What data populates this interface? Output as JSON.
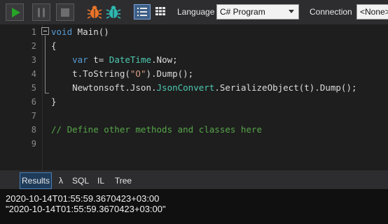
{
  "toolbar": {
    "icons": {
      "run": "play-icon",
      "pause": "pause-icon",
      "stop": "stop-icon",
      "debug": "bug-icon",
      "debug_alt": "bug-alt-icon",
      "rich_text": "rich-text-view-icon",
      "data_grid": "data-grid-view-icon"
    },
    "language_label": "Language",
    "language_value": "C# Program",
    "connection_label": "Connection",
    "connection_value": "<None>"
  },
  "editor": {
    "line_numbers": [
      "1",
      "2",
      "3",
      "4",
      "5",
      "6",
      "7",
      "8",
      "9"
    ],
    "lines": [
      {
        "parts": [
          {
            "t": "void",
            "c": "kw"
          },
          {
            "t": " Main()",
            "c": "pl"
          }
        ]
      },
      {
        "parts": [
          {
            "t": "{",
            "c": "pl"
          }
        ]
      },
      {
        "parts": [
          {
            "t": "    ",
            "c": "pl"
          },
          {
            "t": "var",
            "c": "kw"
          },
          {
            "t": " t= ",
            "c": "pl"
          },
          {
            "t": "DateTime",
            "c": "ty"
          },
          {
            "t": ".Now;",
            "c": "pl"
          }
        ]
      },
      {
        "parts": [
          {
            "t": "    t.ToString(",
            "c": "pl"
          },
          {
            "t": "\"O\"",
            "c": "str"
          },
          {
            "t": ").Dump();",
            "c": "pl"
          }
        ]
      },
      {
        "parts": [
          {
            "t": "    Newtonsoft.Json.",
            "c": "pl"
          },
          {
            "t": "JsonConvert",
            "c": "ty"
          },
          {
            "t": ".SerializeObject(t).Dump();",
            "c": "pl"
          }
        ]
      },
      {
        "parts": [
          {
            "t": "}",
            "c": "pl"
          }
        ]
      },
      {
        "parts": []
      },
      {
        "parts": [
          {
            "t": "// Define other methods and classes here",
            "c": "cm"
          }
        ]
      },
      {
        "parts": []
      }
    ]
  },
  "results": {
    "tabs": [
      "Results",
      "λ",
      "SQL",
      "IL",
      "Tree"
    ],
    "active_tab": "Results",
    "output": [
      "2020-10-14T01:55:59.3670423+03:00",
      "\"2020-10-14T01:55:59.3670423+03:00\""
    ]
  },
  "colors": {
    "run_green": "#27a327",
    "keyword": "#569cd6",
    "type": "#4ec9b0",
    "string": "#d69d85",
    "comment": "#57a64a",
    "active_tab": "#1e3b5a"
  }
}
